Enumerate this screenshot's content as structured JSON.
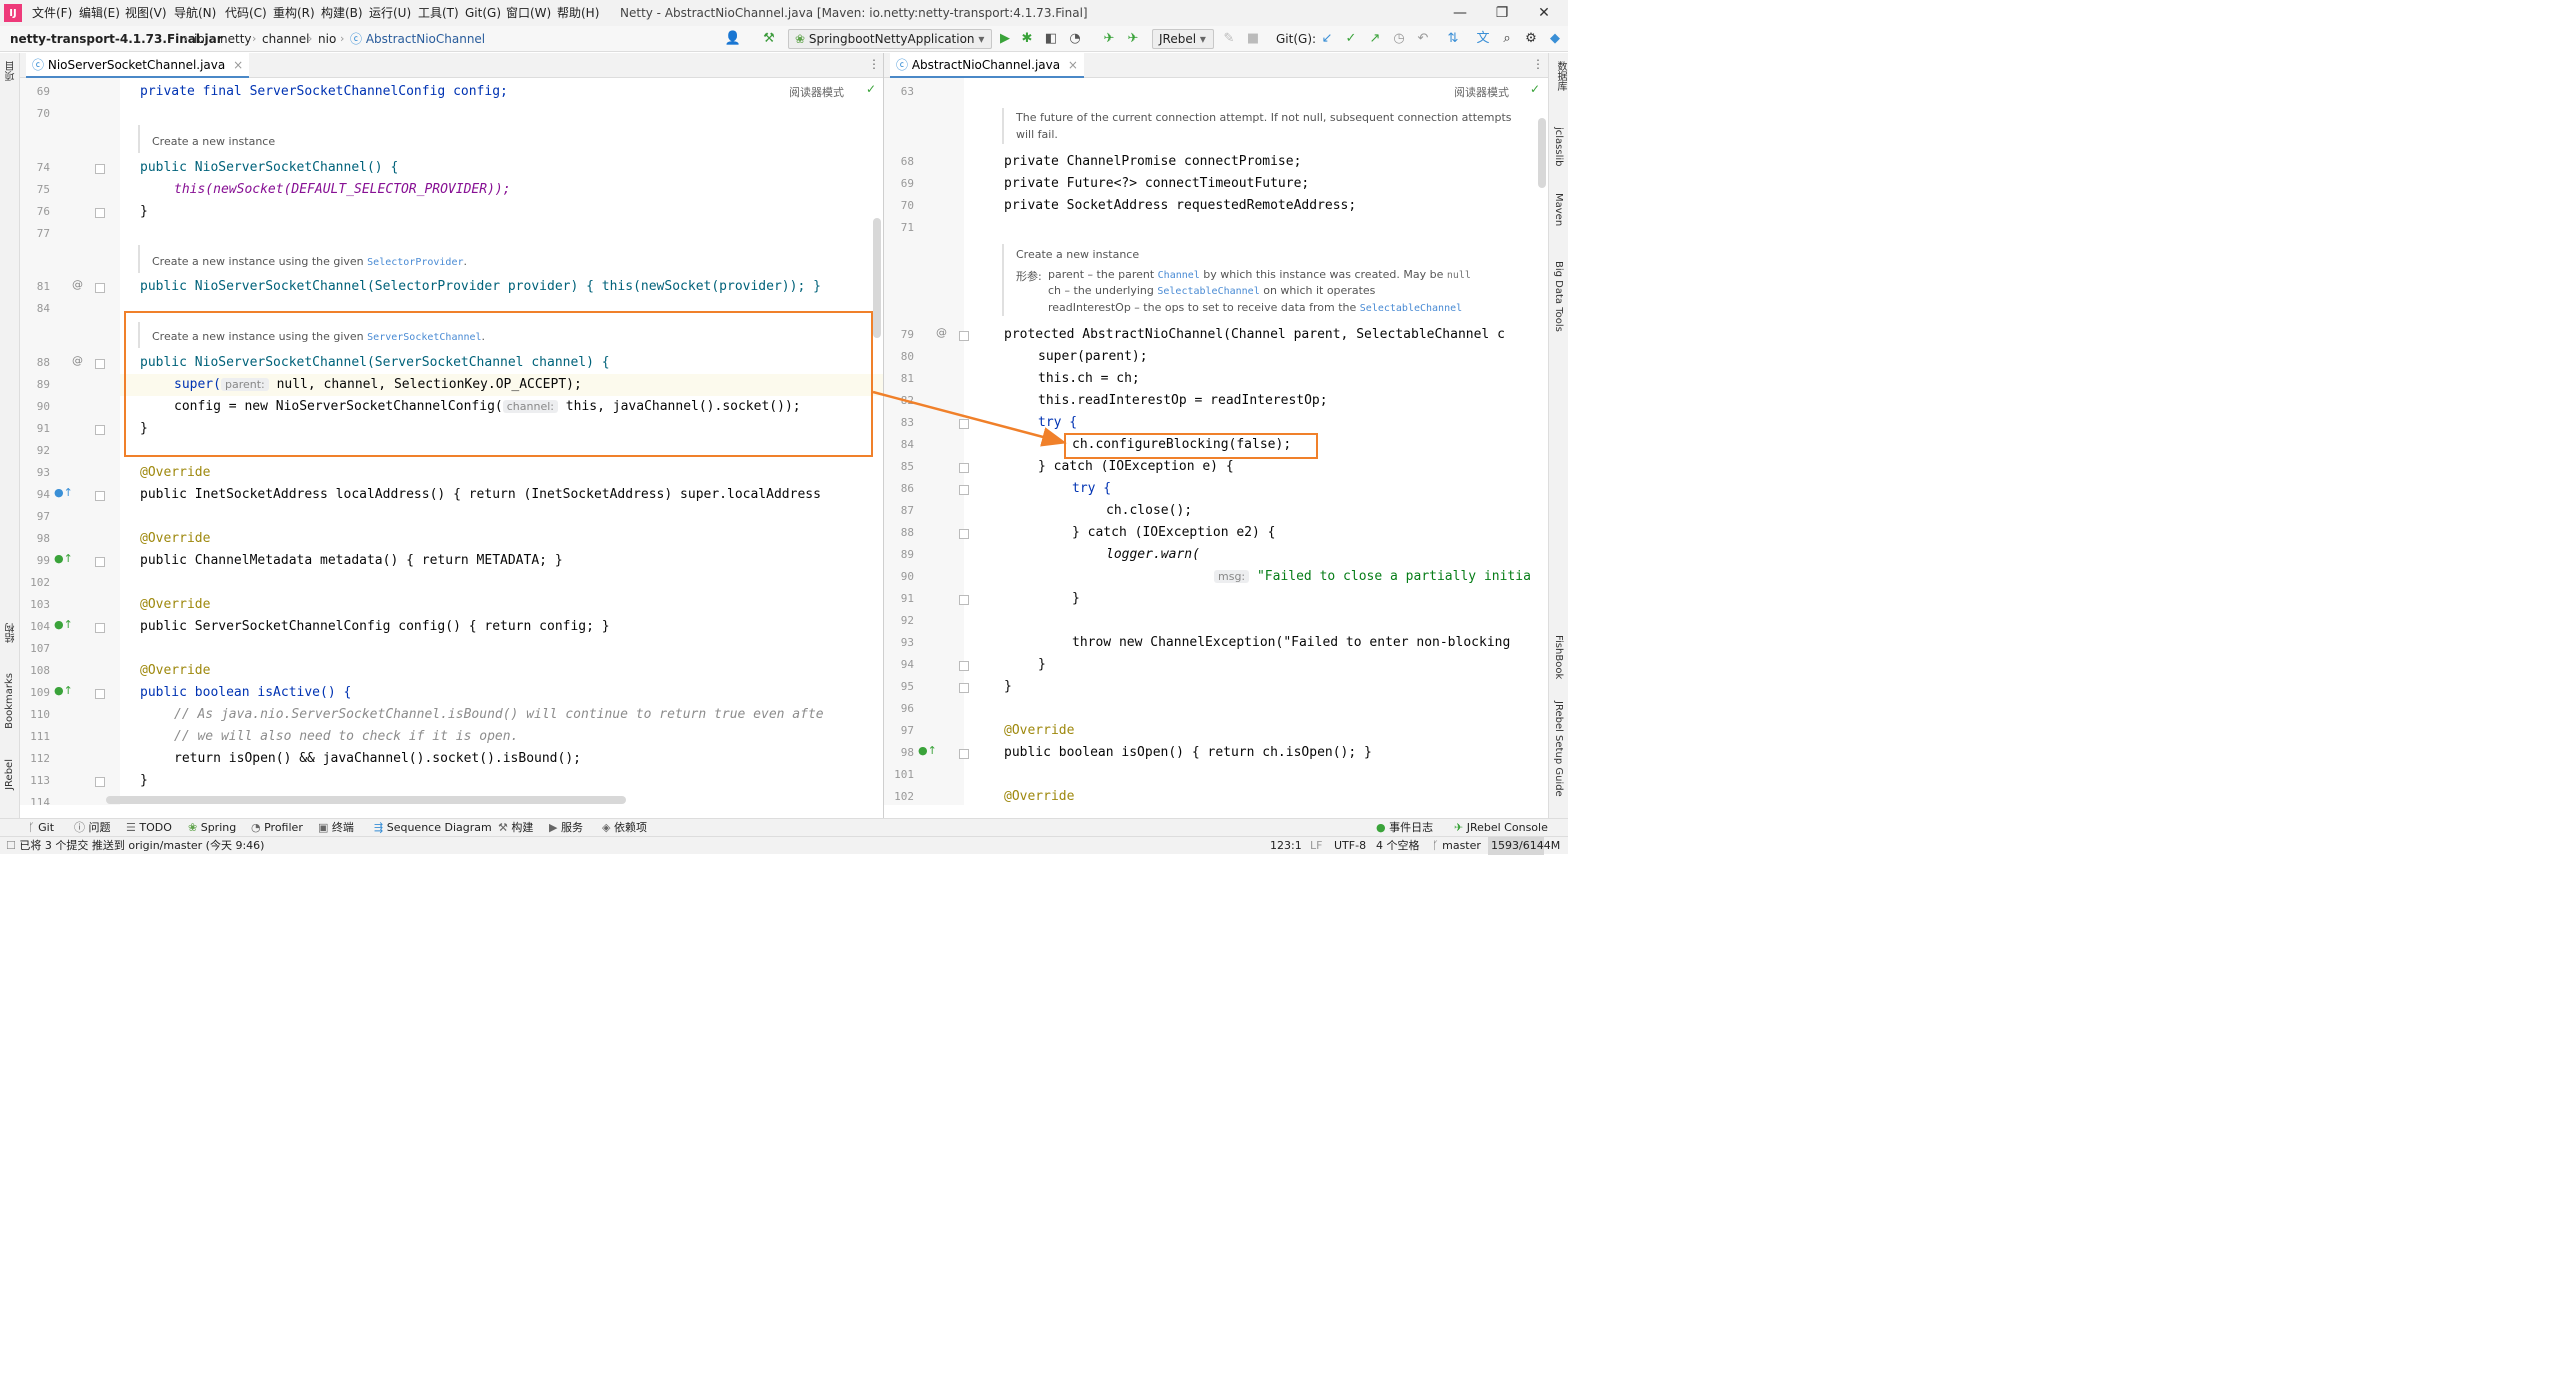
{
  "menubar": {
    "logo": "IJ",
    "items": [
      "文件(F)",
      "编辑(E)",
      "视图(V)",
      "导航(N)",
      "代码(C)",
      "重构(R)",
      "构建(B)",
      "运行(U)",
      "工具(T)",
      "Git(G)",
      "窗口(W)",
      "帮助(H)"
    ],
    "title": "Netty - AbstractNioChannel.java [Maven: io.netty:netty-transport:4.1.73.Final]",
    "minimize": "—",
    "maximize": "❐",
    "close": "✕"
  },
  "navbar": {
    "crumbs": [
      "netty-transport-4.1.73.Final.jar",
      "io",
      "netty",
      "channel",
      "nio",
      "AbstractNioChannel"
    ],
    "run_config": "SpringbootNettyApplication",
    "jrebel": "JRebel",
    "git_label": "Git(G):"
  },
  "left_strip": {
    "top": "项目",
    "middle": "结构",
    "bookmarks": "Bookmarks",
    "jrebel": "JRebel"
  },
  "right_strip": {
    "db": "数据库",
    "jclasslib": "jclasslib",
    "maven": "Maven",
    "bigdata": "Big Data Tools",
    "fishbook": "FishBook",
    "jrebel_guide": "JRebel Setup Guide"
  },
  "left_editor": {
    "tab": "NioServerSocketChannel.java",
    "reader_mode": "阅读器模式",
    "line_numbers": [
      "69",
      "70",
      "",
      "74",
      "75",
      "76",
      "77",
      "",
      "81",
      "84",
      "",
      "88",
      "89",
      "90",
      "91",
      "92",
      "93",
      "94",
      "97",
      "98",
      "99",
      "102",
      "103",
      "104",
      "107",
      "108",
      "109",
      "110",
      "111",
      "112",
      "113",
      "114"
    ],
    "doc1": "Create a new instance",
    "doc2_text": "Create a new instance using the given ",
    "doc2_link": "SelectorProvider",
    "doc3_text": "Create a new instance using the given ",
    "doc3_link": "ServerSocketChannel",
    "hint_parent": "parent:",
    "hint_channel": "channel:",
    "code": {
      "l69": "private final ServerSocketChannelConfig config;",
      "l74": "public NioServerSocketChannel() {",
      "l75": "this(newSocket(DEFAULT_SELECTOR_PROVIDER));",
      "l76": "}",
      "l81": "public NioServerSocketChannel(SelectorProvider provider) { this(newSocket(provider)); }",
      "l88": "public NioServerSocketChannel(ServerSocketChannel channel) {",
      "l89a": "super(",
      "l89b": "null, channel, SelectionKey.OP_ACCEPT);",
      "l90a": "config = new NioServerSocketChannelConfig(",
      "l90b": "this, javaChannel().socket());",
      "l91": "}",
      "l93": "@Override",
      "l94": "public InetSocketAddress localAddress() { return (InetSocketAddress) super.localAddress",
      "l98": "@Override",
      "l99": "public ChannelMetadata metadata() { return METADATA; }",
      "l103": "@Override",
      "l104": "public ServerSocketChannelConfig config() { return config; }",
      "l108": "@Override",
      "l109": "public boolean isActive() {",
      "l110": "// As java.nio.ServerSocketChannel.isBound() will continue to return true even afte",
      "l111": "// we will also need to check if it is open.",
      "l112": "return isOpen() && javaChannel().socket().isBound();",
      "l113": "}"
    }
  },
  "right_editor": {
    "tab": "AbstractNioChannel.java",
    "reader_mode": "阅读器模式",
    "line_numbers": [
      "63",
      "",
      "",
      "68",
      "69",
      "70",
      "71",
      "",
      "",
      "",
      "",
      "79",
      "80",
      "81",
      "82",
      "83",
      "84",
      "85",
      "86",
      "87",
      "88",
      "89",
      "90",
      "91",
      "92",
      "93",
      "94",
      "95",
      "96",
      "97",
      "98",
      "101",
      "102"
    ],
    "doc1_l1": "The future of the current connection attempt. If not null, subsequent connection attempts",
    "doc1_l2": "will fail.",
    "doc2_title": "Create a new instance",
    "doc2_params_label": "形参:",
    "doc2_p1a": "parent – the parent ",
    "doc2_p1b": "Channel",
    "doc2_p1c": " by which this instance was created. May be ",
    "doc2_p1d": "null",
    "doc2_p2a": "ch – the underlying ",
    "doc2_p2b": "SelectableChannel",
    "doc2_p2c": " on which it operates",
    "doc2_p3a": "readInterestOp – the ops to set to receive data from the ",
    "doc2_p3b": "SelectableChannel",
    "hint_msg": "msg:",
    "code": {
      "l68": "private ChannelPromise connectPromise;",
      "l69": "private Future<?> connectTimeoutFuture;",
      "l70": "private SocketAddress requestedRemoteAddress;",
      "l79": "protected AbstractNioChannel(Channel parent, SelectableChannel c",
      "l80": "super(parent);",
      "l81": "this.ch = ch;",
      "l82": "this.readInterestOp = readInterestOp;",
      "l83": "try {",
      "l84": "ch.configureBlocking(false);",
      "l85": "} catch (IOException e) {",
      "l86": "try {",
      "l87": "ch.close();",
      "l88": "} catch (IOException e2) {",
      "l89": "logger.warn(",
      "l90": "\"Failed to close a partially initia",
      "l91": "}",
      "l93": "throw new ChannelException(\"Failed to enter non-blocking",
      "l94": "}",
      "l95": "}",
      "l97": "@Override",
      "l98": "public boolean isOpen() { return ch.isOpen(); }",
      "l102": "@Override"
    }
  },
  "statusbar": {
    "tools": [
      "Git",
      "问题",
      "TODO",
      "Spring",
      "Profiler",
      "终端",
      "Sequence Diagram",
      "构建",
      "服务",
      "依赖项"
    ],
    "right": [
      "事件日志",
      "JRebel Console"
    ]
  },
  "bottombar": {
    "message": "已将 3 个提交 推送到 origin/master (今天 9:46)",
    "position": "123:1",
    "line_sep": "LF",
    "encoding": "UTF-8",
    "indent": "4 个空格",
    "branch": "master",
    "memory": "1593/6144M"
  },
  "colors": {
    "accent": "#4a88c7",
    "highlight": "#f0802a",
    "keyword": "#0033b3",
    "field": "#871094",
    "method": "#00627a"
  }
}
